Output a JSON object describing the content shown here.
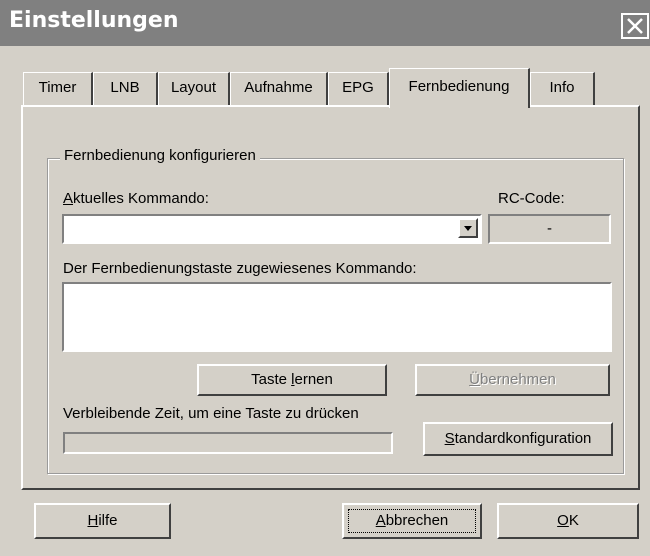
{
  "window": {
    "title": "Einstellungen",
    "close_icon": "close-icon"
  },
  "tabs": [
    {
      "label": "Timer",
      "active": false
    },
    {
      "label": "LNB",
      "active": false
    },
    {
      "label": "Layout",
      "active": false
    },
    {
      "label": "Aufnahme",
      "active": false
    },
    {
      "label": "EPG",
      "active": false
    },
    {
      "label": "Fernbedienung",
      "active": true
    },
    {
      "label": "Info",
      "active": false
    }
  ],
  "group": {
    "title": "Fernbedienung konfigurieren",
    "current_command_label_u": "A",
    "current_command_label_rest": "ktuelles Kommando:",
    "current_command_value": "",
    "rc_code_label": "RC-Code:",
    "rc_code_value": "-",
    "assigned_label": "Der Fernbedienungstaste zugewiesenes Kommando:",
    "assigned_value": "",
    "learn_button_pre": "Taste ",
    "learn_button_u": "l",
    "learn_button_post": "ernen",
    "apply_button_u": "Ü",
    "apply_button_rest": "bernehmen",
    "remaining_label": "Verbleibende Zeit, um eine Taste zu drücken",
    "default_button_u": "S",
    "default_button_rest": "tandardkonfiguration"
  },
  "footer": {
    "help_u": "H",
    "help_rest": "ilfe",
    "cancel_u": "A",
    "cancel_rest": "bbrechen",
    "ok_u": "O",
    "ok_rest": "K"
  }
}
